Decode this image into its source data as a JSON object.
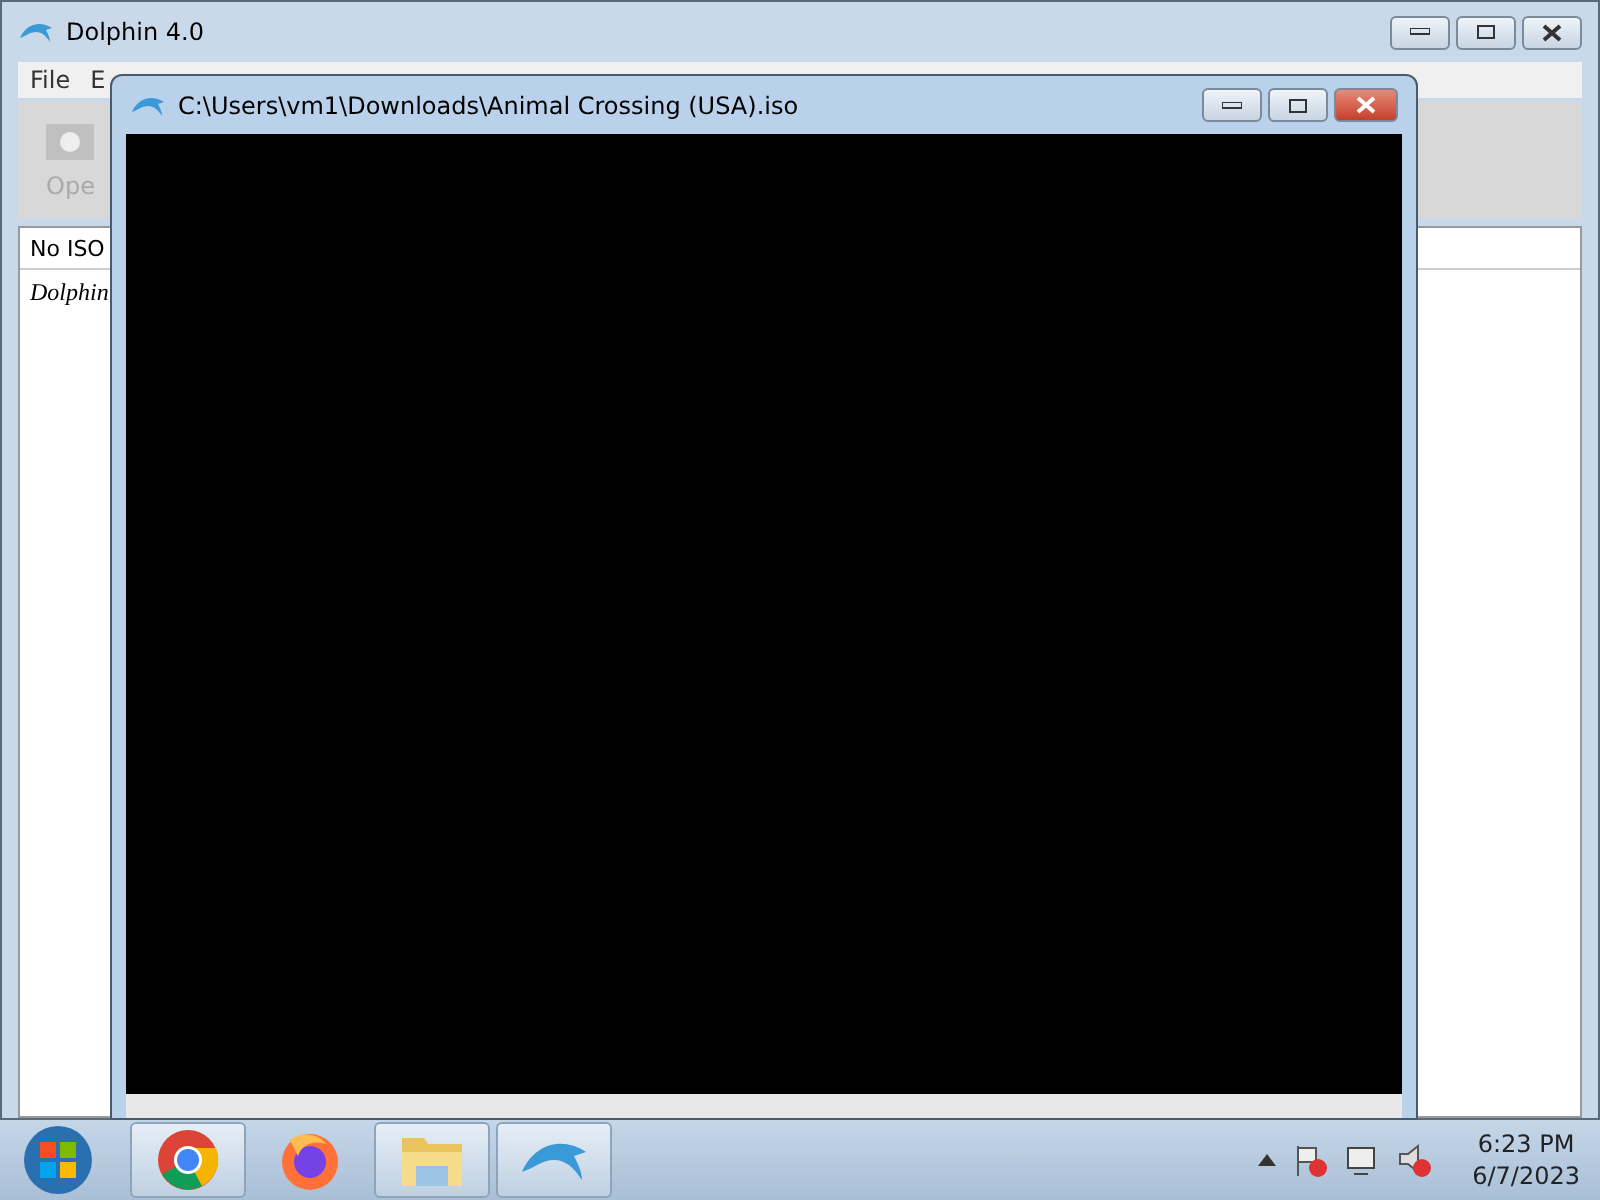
{
  "main_window": {
    "title": "Dolphin 4.0",
    "menu": [
      "File",
      "E"
    ],
    "toolbar": [
      {
        "label": "Ope"
      }
    ],
    "list_header": "No ISO",
    "list_rows": [
      "Dolphin"
    ]
  },
  "render_window": {
    "title": "C:\\Users\\vm1\\Downloads\\Animal Crossing (USA).iso"
  },
  "taskbar": {
    "apps": [
      {
        "kind": "chrome",
        "running": true
      },
      {
        "kind": "firefox",
        "running": false
      },
      {
        "kind": "explorer",
        "running": true
      },
      {
        "kind": "dolphin",
        "running": true
      }
    ],
    "time": "6:23 PM",
    "date": "6/7/2023"
  }
}
